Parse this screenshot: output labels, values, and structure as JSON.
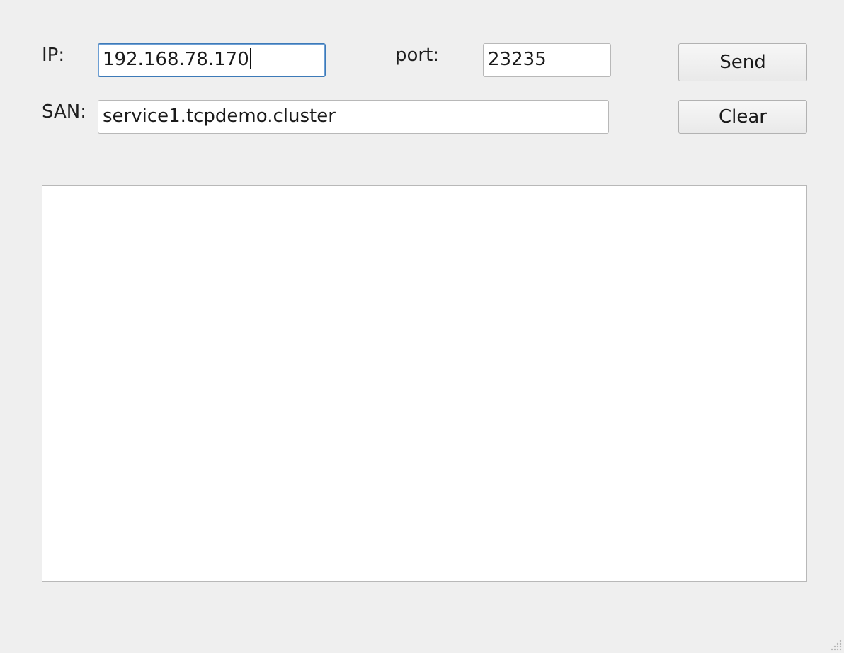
{
  "form": {
    "ip_label": "IP:",
    "ip_value": "192.168.78.170",
    "port_label": "port:",
    "port_value": "23235",
    "san_label": "SAN:",
    "san_value": "service1.tcpdemo.cluster"
  },
  "buttons": {
    "send_label": "Send",
    "clear_label": "Clear"
  },
  "output": {
    "text": ""
  },
  "icons": {
    "resize_grip": "resize-grip-icon"
  }
}
